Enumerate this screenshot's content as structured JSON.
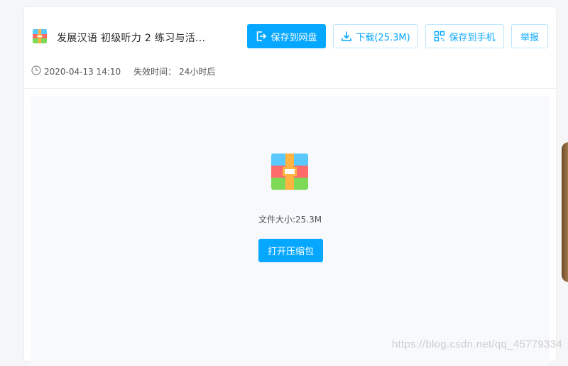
{
  "colors": {
    "accent": "#06a7ff",
    "zip_top": "#5ac8fa",
    "zip_mid": "#ff6b6b",
    "zip_bottom": "#7ed957",
    "zip_strap": "#ffb340"
  },
  "file": {
    "icon": "zip-archive-icon",
    "title": "发展汉语  初级听力  2  练习与活...",
    "date": "2020-04-13 14:10",
    "expiry_label": "失效时间：",
    "expiry_value": "24小时后"
  },
  "actions": {
    "save_cloud": {
      "label": "保存到网盘",
      "icon": "save-to-cloud-icon"
    },
    "download": {
      "label": "下载(25.3M)",
      "icon": "download-icon"
    },
    "save_phone": {
      "label": "保存到手机",
      "icon": "qr-code-icon"
    },
    "report": {
      "label": "举报"
    }
  },
  "preview": {
    "icon": "zip-archive-icon",
    "size_text": "文件大小:25.3M",
    "open_label": "打开压缩包"
  },
  "watermark": "https://blog.csdn.net/qq_45779334"
}
